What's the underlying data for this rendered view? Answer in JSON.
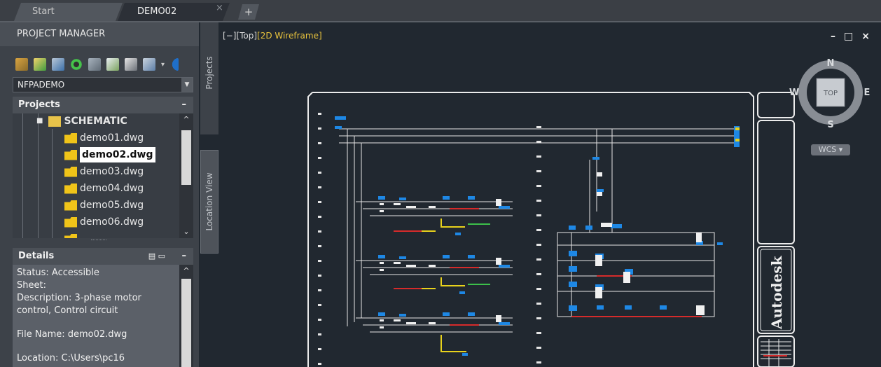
{
  "tabs": {
    "start": "Start",
    "active": "DEMO02",
    "close": "×",
    "new": "+"
  },
  "panel": {
    "title": "PROJECT MANAGER",
    "project_selected": "NFPADEMO",
    "projects_header": "Projects",
    "folder": "SCHEMATIC",
    "files": [
      "demo01.dwg",
      "demo02.dwg",
      "demo03.dwg",
      "demo04.dwg",
      "demo05.dwg",
      "demo06.dwg"
    ],
    "selected_file": "demo02.dwg",
    "details_header": "Details",
    "details": {
      "status": "Status: Accessible",
      "sheet": "Sheet:",
      "desc1": "Description: 3-phase motor",
      "desc2": "control, Control circuit",
      "filename": "File Name: demo02.dwg",
      "location": "Location: C:\\Users\\pc16"
    },
    "side_tabs": [
      "Projects",
      "Location View"
    ]
  },
  "viewport": {
    "label_bracket": "[−][Top]",
    "label_style": "[2D Wireframe]",
    "label_style_color": "#e7c23d",
    "window_controls": [
      "–",
      "□",
      "×"
    ]
  },
  "viewcube": {
    "n": "N",
    "s": "S",
    "e": "E",
    "w": "W",
    "face": "TOP",
    "wcs": "WCS"
  },
  "titleblock": {
    "brand": "Autodesk"
  },
  "colors": {
    "canvas_bg": "#212830",
    "wire": "#e6e6e6",
    "component_blue": "#1e88e5",
    "wire_red": "#d62b2b",
    "wire_yellow": "#e8d21c",
    "wire_green": "#3cbf4a"
  }
}
